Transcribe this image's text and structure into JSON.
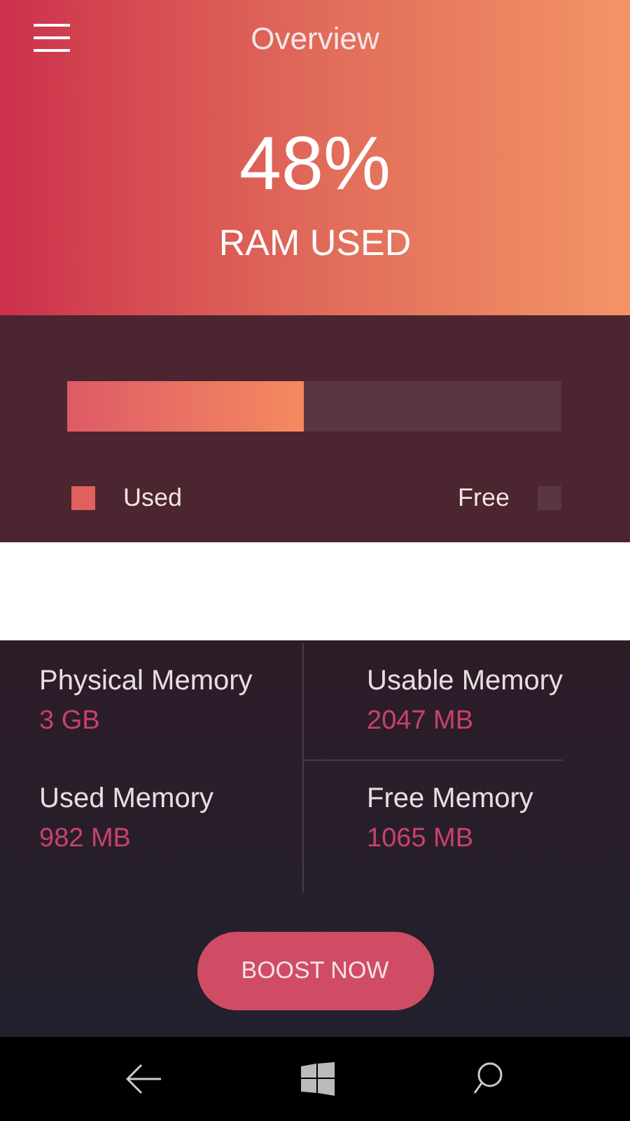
{
  "header": {
    "title": "Overview",
    "percent": "48%",
    "caption": "RAM USED"
  },
  "usage": {
    "level": 0.48,
    "legend": [
      {
        "label": "Used",
        "kind": "used",
        "color": "#e0605e"
      },
      {
        "label": "Free",
        "kind": "free",
        "color": "#5a3640"
      }
    ]
  },
  "stats": [
    {
      "label": "Physical Memory",
      "value": "3 GB"
    },
    {
      "label": "Usable Memory",
      "value": "2047 MB"
    },
    {
      "label": "Used Memory",
      "value": "982 MB"
    },
    {
      "label": "Free Memory",
      "value": "1065 MB"
    }
  ],
  "boost_button": "BOOST NOW"
}
